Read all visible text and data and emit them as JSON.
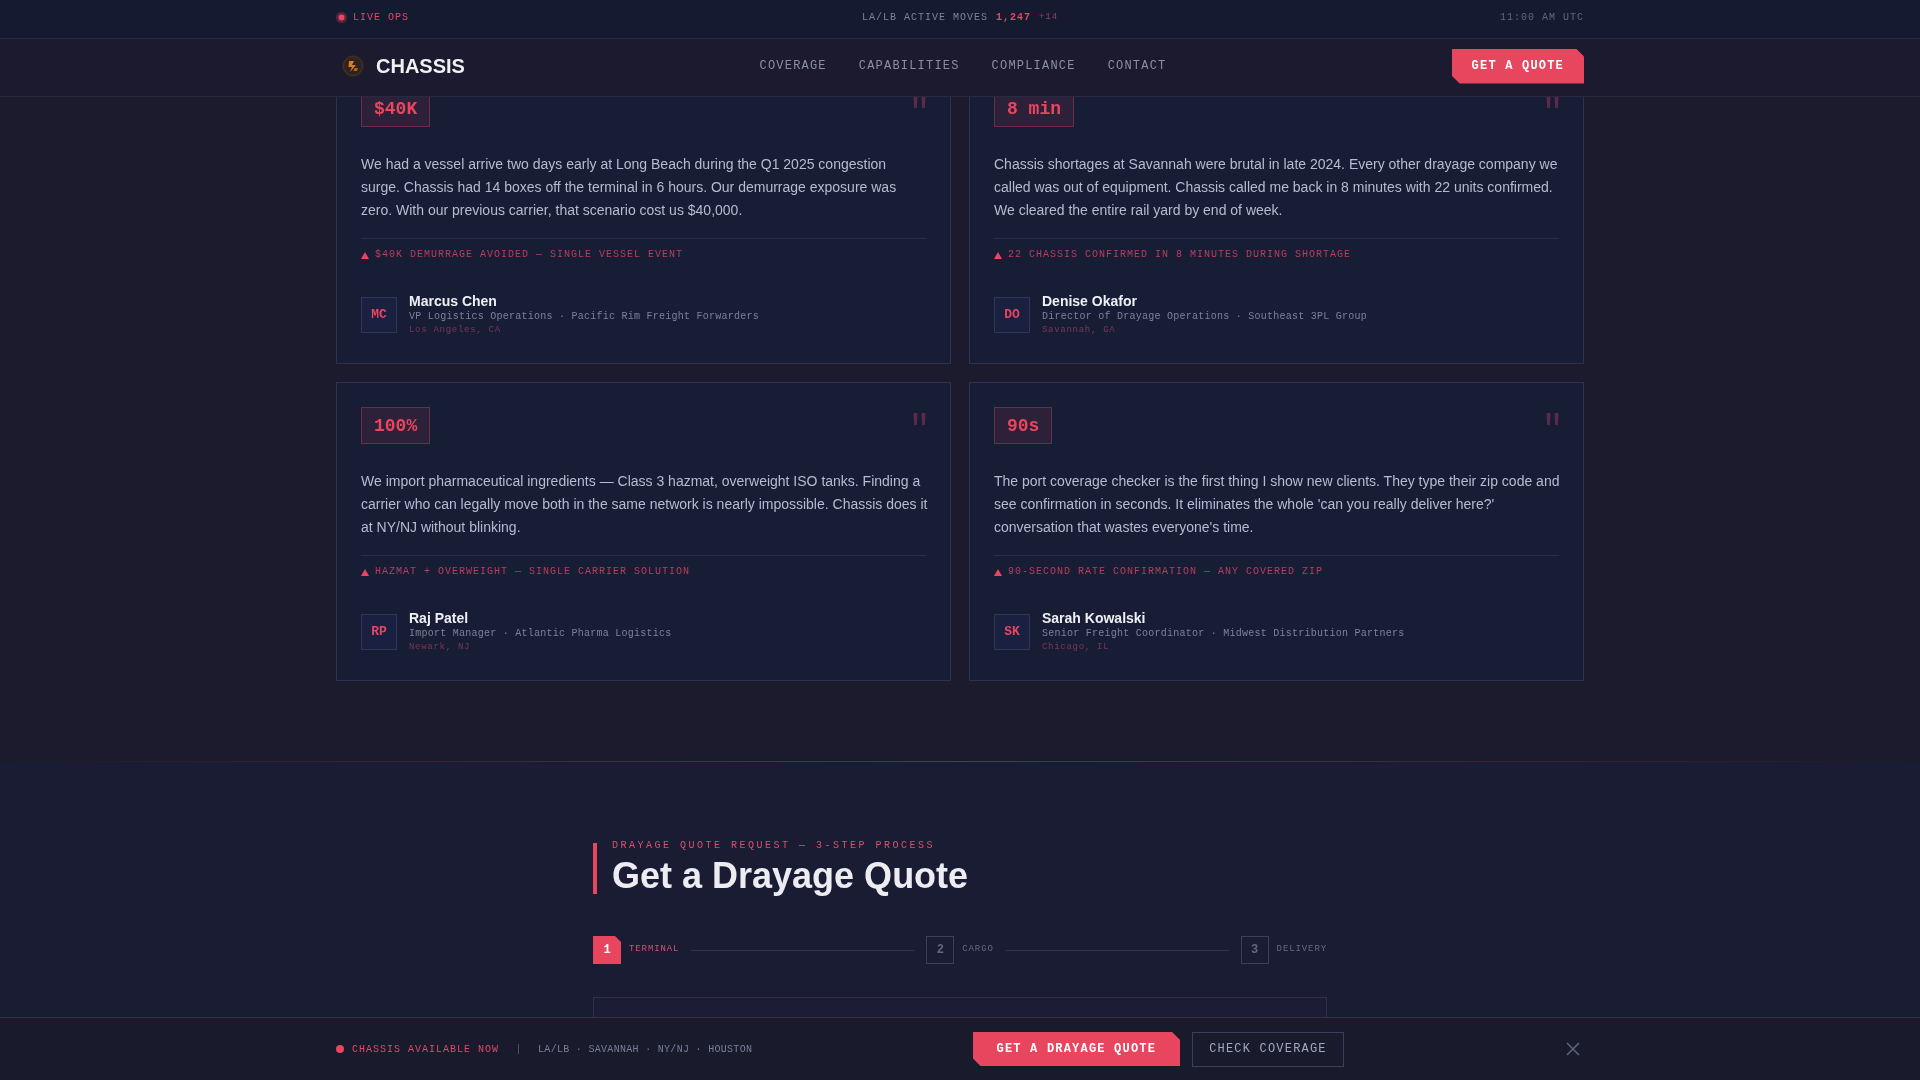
{
  "ticker": {
    "live_label": "LIVE OPS",
    "metric_label": "LA/LB ACTIVE MOVES",
    "metric_value": "1,247",
    "metric_delta": "+14",
    "clock": "11:00 AM UTC"
  },
  "nav": {
    "brand": "CHASSIS",
    "links": [
      "COVERAGE",
      "CAPABILITIES",
      "COMPLIANCE",
      "CONTACT"
    ],
    "cta": "GET A QUOTE"
  },
  "testimonials": [
    {
      "stat": "$40K",
      "quote": "We had a vessel arrive two days early at Long Beach during the Q1 2025 congestion surge. Chassis had 14 boxes off the terminal in 6 hours. Our demurrage exposure was zero. With our previous carrier, that scenario cost us $40,000.",
      "outcome": "$40K DEMURRAGE AVOIDED — SINGLE VESSEL EVENT",
      "initials": "MC",
      "name": "Marcus Chen",
      "role": "VP Logistics Operations · Pacific Rim Freight Forwarders",
      "location": "Los Angeles, CA"
    },
    {
      "stat": "8 min",
      "quote": "Chassis shortages at Savannah were brutal in late 2024. Every other drayage company we called was out of equipment. Chassis called me back in 8 minutes with 22 units confirmed. We cleared the entire rail yard by end of week.",
      "outcome": "22 CHASSIS CONFIRMED IN 8 MINUTES DURING SHORTAGE",
      "initials": "DO",
      "name": "Denise Okafor",
      "role": "Director of Drayage Operations · Southeast 3PL Group",
      "location": "Savannah, GA"
    },
    {
      "stat": "100%",
      "quote": "We import pharmaceutical ingredients — Class 3 hazmat, overweight ISO tanks. Finding a carrier who can legally move both in the same network is nearly impossible. Chassis does it at NY/NJ without blinking.",
      "outcome": "HAZMAT + OVERWEIGHT — SINGLE CARRIER SOLUTION",
      "initials": "RP",
      "name": "Raj Patel",
      "role": "Import Manager · Atlantic Pharma Logistics",
      "location": "Newark, NJ"
    },
    {
      "stat": "90s",
      "quote": "The port coverage checker is the first thing I show new clients. They type their zip code and see confirmation in seconds. It eliminates the whole 'can you really deliver here?' conversation that wastes everyone's time.",
      "outcome": "90-SECOND RATE CONFIRMATION — ANY COVERED ZIP",
      "initials": "SK",
      "name": "Sarah Kowalski",
      "role": "Senior Freight Coordinator · Midwest Distribution Partners",
      "location": "Chicago, IL"
    }
  ],
  "quote_section": {
    "overline": "DRAYAGE QUOTE REQUEST — 3-STEP PROCESS",
    "title": "Get a Drayage Quote",
    "steps": [
      {
        "number": "1",
        "label": "TERMINAL",
        "active": true
      },
      {
        "number": "2",
        "label": "CARGO",
        "active": false
      },
      {
        "number": "3",
        "label": "DELIVERY",
        "active": false
      }
    ]
  },
  "sticky_bar": {
    "status": "CHASSIS AVAILABLE NOW",
    "ports": "LA/LB · SAVANNAH · NY/NJ · HOUSTON",
    "buttons": [
      {
        "label": "GET A DRAYAGE QUOTE",
        "kind": "primary"
      },
      {
        "label": "CHECK COVERAGE",
        "kind": "secondary"
      }
    ]
  }
}
